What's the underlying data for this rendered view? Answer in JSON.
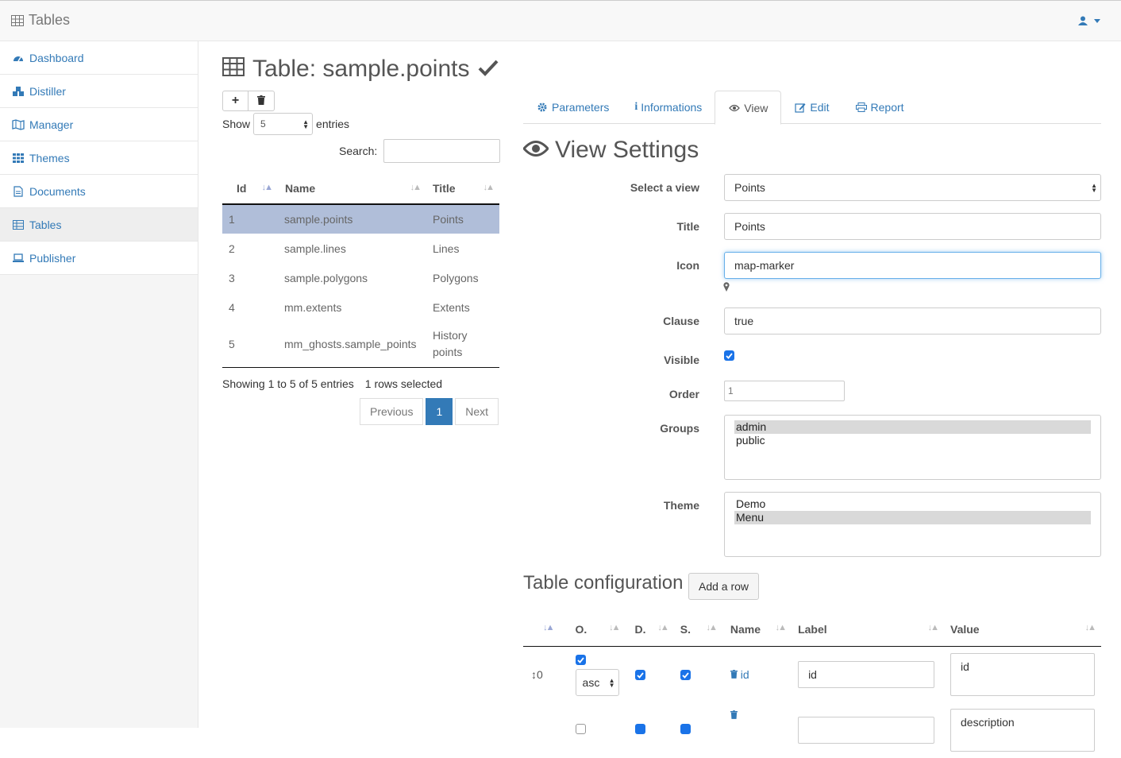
{
  "navbar": {
    "brand": "Tables",
    "brand_icon": "table-icon",
    "user_icon": "user-icon"
  },
  "sidebar": {
    "items": [
      {
        "label": "Dashboard",
        "icon": "dashboard-icon"
      },
      {
        "label": "Distiller",
        "icon": "cubes-icon"
      },
      {
        "label": "Manager",
        "icon": "map-icon"
      },
      {
        "label": "Themes",
        "icon": "th-icon"
      },
      {
        "label": "Documents",
        "icon": "file-icon"
      },
      {
        "label": "Tables",
        "icon": "table-icon",
        "active": true
      },
      {
        "label": "Publisher",
        "icon": "laptop-icon"
      }
    ]
  },
  "page": {
    "title": "Table: sample.points"
  },
  "left_table": {
    "show_label": "Show",
    "entries_value": "5",
    "entries_label": "entries",
    "search_label": "Search:",
    "columns": [
      "Id",
      "Name",
      "Title"
    ],
    "rows": [
      {
        "id": "1",
        "name": "sample.points",
        "title": "Points",
        "selected": true
      },
      {
        "id": "2",
        "name": "sample.lines",
        "title": "Lines"
      },
      {
        "id": "3",
        "name": "sample.polygons",
        "title": "Polygons"
      },
      {
        "id": "4",
        "name": "mm.extents",
        "title": "Extents"
      },
      {
        "id": "5",
        "name": "mm_ghosts.sample_points",
        "title": "History points"
      }
    ],
    "info": "Showing 1 to 5 of 5 entries",
    "selected_info": "1 rows selected",
    "pager": {
      "previous": "Previous",
      "current": "1",
      "next": "Next"
    }
  },
  "tabs": [
    {
      "label": "Parameters",
      "icon": "cog-icon"
    },
    {
      "label": "Informations",
      "icon": "info-icon"
    },
    {
      "label": "View",
      "icon": "eye-icon",
      "active": true
    },
    {
      "label": "Edit",
      "icon": "edit-icon"
    },
    {
      "label": "Report",
      "icon": "print-icon"
    }
  ],
  "view_settings": {
    "heading": "View Settings",
    "select_view_label": "Select a view",
    "select_view_value": "Points",
    "title_label": "Title",
    "title_value": "Points",
    "icon_label": "Icon",
    "icon_value": "map-marker",
    "clause_label": "Clause",
    "clause_value": "true",
    "visible_label": "Visible",
    "visible_checked": true,
    "order_label": "Order",
    "order_value": "1",
    "groups_label": "Groups",
    "groups": [
      {
        "label": "admin",
        "selected": true
      },
      {
        "label": "public"
      }
    ],
    "theme_label": "Theme",
    "themes": [
      {
        "label": "Demo"
      },
      {
        "label": "Menu",
        "selected": true
      }
    ]
  },
  "table_config": {
    "heading": "Table configuration",
    "add_row": "Add a row",
    "columns": [
      "O.",
      "D.",
      "S.",
      "Name",
      "Label",
      "Value"
    ],
    "rows": [
      {
        "order": "0",
        "sort": "asc",
        "name": "id",
        "label": "id",
        "value": "id"
      },
      {
        "order": "",
        "sort": "",
        "name": "",
        "label": "",
        "value": "description"
      }
    ]
  }
}
